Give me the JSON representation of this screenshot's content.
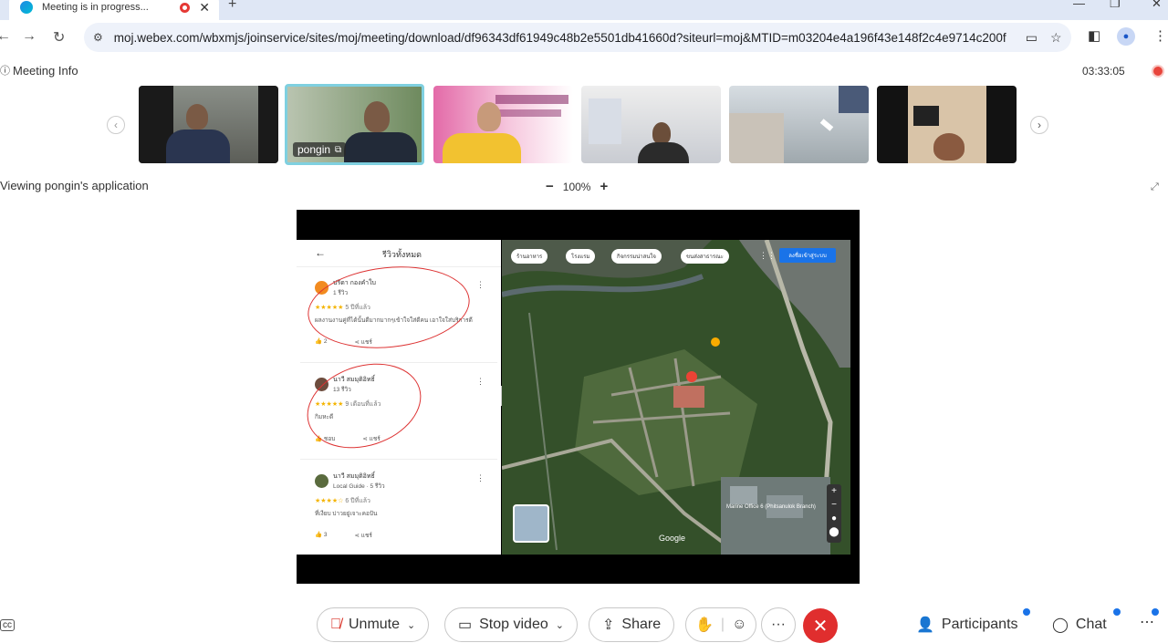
{
  "browser": {
    "tab_title": "Meeting is in progress...",
    "new_tab": "+",
    "url": "moj.webex.com/wbxmjs/joinservice/sites/moj/meeting/download/df96343df61949c48b2e5501db41660d?siteurl=moj&MTID=m03204e4a196f43e148f2c4e9714c200f"
  },
  "meeting": {
    "info_label": "Meeting Info",
    "timer": "03:33:05",
    "viewing_label": "Viewing pongin's application",
    "zoom_minus": "−",
    "zoom_value": "100%",
    "zoom_plus": "+",
    "active_participant": "pongin"
  },
  "shared": {
    "panel_title": "รีวิวทั้งหมด",
    "reviews": [
      {
        "name": "ปรีดา กองคำใบ",
        "sub": "1 รีวิว",
        "stars": "★★★★★",
        "meta": "5 ปีที่แล้ว",
        "text": "ผลงานงานคู่ที่ได้นั้นดีมากมากๆเข้าใจใส่ดีคน เอาใจใส่บริการดี",
        "likes": "2",
        "share": "แชร์"
      },
      {
        "name": "นาวี สมมุติอิทธิ์",
        "sub": "13 รีวิว",
        "stars": "★★★★★",
        "meta": "9 เดือนที่แล้ว",
        "text": "กิมหะดี",
        "likes": "ชอบ",
        "share": "แชร์"
      },
      {
        "name": "นาวี สมมุติอิทธิ์",
        "sub": "Local Guide · 5 รีวิว",
        "stars": "★★★★☆",
        "meta": "6 ปีที่แล้ว",
        "text": "ที่เงียบ บ่าวยยู่เจาะคอปัน",
        "likes": "3",
        "share": "แชร์"
      }
    ],
    "map_chips": [
      "ร้านอาหาร",
      "โรงแรม",
      "กิจกรรมน่าสนใจ",
      "ขนส่งสาธารณะ"
    ],
    "map_button": "ลงชื่อเข้าสู่ระบบ",
    "map_labels": [
      "Google",
      "Marine Office 6 (Phitsanulok Branch)"
    ]
  },
  "controls": {
    "unmute": "Unmute",
    "stop_video": "Stop video",
    "share": "Share",
    "more": "···",
    "participants": "Participants",
    "chat": "Chat"
  },
  "colors": {
    "accent": "#1a73e8",
    "end_call": "#e02e2e",
    "mute_red": "#d93025",
    "active_border": "#7fd0e0"
  }
}
